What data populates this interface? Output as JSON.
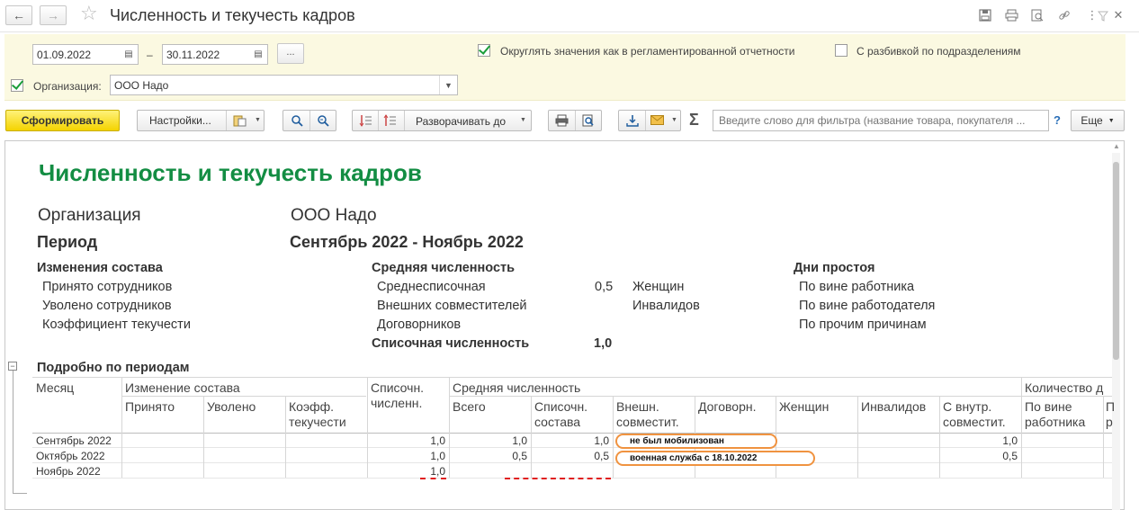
{
  "window": {
    "title": "Численность и текучесть кадров"
  },
  "filter": {
    "date_from": "01.09.2022",
    "date_dash": "–",
    "date_to": "30.11.2022",
    "dots": "...",
    "round_label": "Округлять значения как в регламентированной отчетности",
    "round_checked": true,
    "split_label": "С разбивкой по подразделениям",
    "split_checked": false,
    "org_label": "Организация:",
    "org_checked": true,
    "org_value": "ООО Надо"
  },
  "toolbar": {
    "generate": "Сформировать",
    "settings": "Настройки...",
    "expand": "Разворачивать до",
    "search_placeholder": "Введите слово для фильтра (название товара, покупателя ...",
    "help": "?",
    "more": "Еще",
    "sigma": "Σ"
  },
  "report": {
    "title": "Численность и текучесть кадров",
    "org_label": "Организация",
    "org_value": "ООО Надо",
    "period_label": "Период",
    "period_value": "Сентябрь 2022 - Ноябрь 2022",
    "changes": {
      "heading": "Изменения состава",
      "items": [
        "Принято сотрудников",
        "Уволено сотрудников",
        "Коэффициент текучести"
      ]
    },
    "avg": {
      "heading": "Средняя численность",
      "items": [
        "Среднесписочная",
        "Внешних совместителей",
        "Договорников"
      ],
      "avg_value": "0,5",
      "women": "Женщин",
      "disabled": "Инвалидов",
      "list_label": "Списочная численность",
      "list_value": "1,0"
    },
    "downtime": {
      "heading": "Дни простоя",
      "items": [
        "По вине работника",
        "По вине работодателя",
        "По прочим причинам"
      ]
    },
    "detail_heading": "Подробно по периодам",
    "table": {
      "col_month": "Месяц",
      "grp_change": "Изменение состава",
      "col_hired": "Принято",
      "col_fired": "Уволено",
      "col_coef": "Коэфф.\nтекучести",
      "col_list": "Списочн.\nчисленн.",
      "grp_avg": "Средняя численность",
      "col_total": "Всего",
      "col_list_comp": "Списочн.\nсостава",
      "col_ext": "Внешн.\nсовместит.",
      "col_contract": "Договорн.",
      "col_women": "Женщин",
      "col_disabled": "Инвалидов",
      "col_internal": "С внутр.\nсовместит.",
      "grp_count": "Количество д",
      "col_emp_fault": "По вине\nработника",
      "col_next": "П\nр",
      "rows": [
        {
          "month": "Сентябрь 2022",
          "list": "1,0",
          "total": "1,0",
          "list_comp": "1,0",
          "internal": "1,0"
        },
        {
          "month": "Октябрь 2022",
          "list": "1,0",
          "total": "0,5",
          "list_comp": "0,5",
          "internal": "0,5"
        },
        {
          "month": "Ноябрь 2022",
          "list": "1,0",
          "total": "",
          "list_comp": "",
          "internal": ""
        }
      ]
    },
    "notes": [
      "не был мобилизован",
      "военная служба с 18.10.2022"
    ]
  },
  "colors": {
    "title_green": "#138d43",
    "filter_bg": "#fbf9e1",
    "primary_yellow": "#f4d300",
    "note_orange": "#f09340",
    "dash_red": "#e02020"
  }
}
